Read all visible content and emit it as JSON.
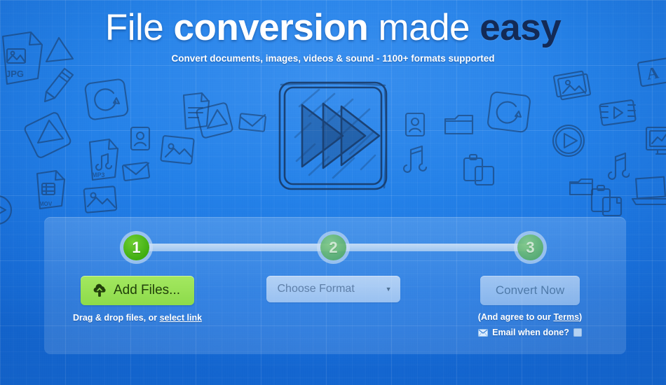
{
  "hero": {
    "headline_part1": "File ",
    "headline_part2": "conversion ",
    "headline_part3": "made ",
    "headline_part4": "easy",
    "subtitle": "Convert documents, images, videos & sound - 1100+ formats supported"
  },
  "center_graphic": {
    "icon": "fast-forward-sketch-icon",
    "description": "Hand-drawn rounded square containing three overlapping right-pointing triangles"
  },
  "steps": [
    {
      "number": "1",
      "state": "active"
    },
    {
      "number": "2",
      "state": "idle"
    },
    {
      "number": "3",
      "state": "idle"
    }
  ],
  "step1": {
    "button_label": "Add Files...",
    "button_icon": "cloud-upload-icon",
    "hint_prefix": "Drag & drop files, or ",
    "hint_link": "select link"
  },
  "step2": {
    "select_label": "Choose Format",
    "caret_icon": "chevron-down-icon"
  },
  "step3": {
    "button_label": "Convert Now",
    "terms_prefix": "(And agree to our ",
    "terms_link": "Terms",
    "terms_suffix": ")",
    "email_icon": "envelope-icon",
    "email_label": "Email when done?",
    "email_checked": "false"
  },
  "doodle_icons": [
    "jpg-file-icon",
    "pencil-icon",
    "refresh-icon",
    "play-triangle-icon",
    "mp3-file-icon",
    "envelope-icon",
    "mov-file-icon",
    "photo-icon",
    "contact-card-icon",
    "photos-stack-icon",
    "film-strip-icon",
    "play-circle-icon",
    "music-note-icon",
    "folder-icon",
    "clipboard-copy-icon",
    "text-a-icon",
    "monitor-chart-icon",
    "laptop-icon",
    "document-icon"
  ],
  "colors": {
    "background_blue": "#1d79e4",
    "background_blue_light": "#3a90ef",
    "headline_white": "#ffffff",
    "headline_navy": "#132a56",
    "step_active_green": "#4cb81e",
    "step_idle_green": "#48a658",
    "add_button_green": "#8ddb4b",
    "add_button_text": "#20400a",
    "doodle_stroke": "#1b3f6e",
    "panel_overlay": "rgba(255,255,255,0.15)"
  }
}
